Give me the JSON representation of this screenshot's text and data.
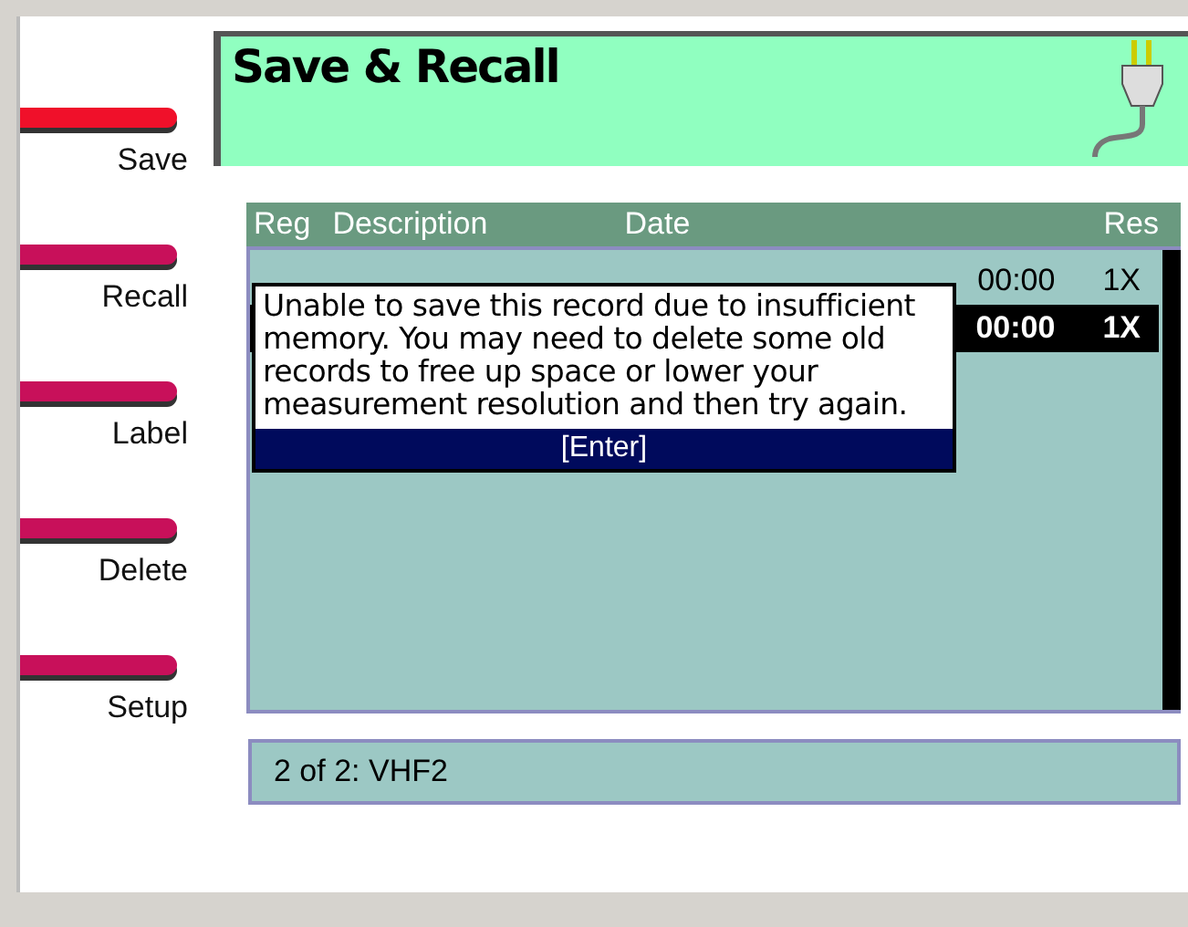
{
  "softkeys": [
    {
      "label": "Save",
      "selected": true
    },
    {
      "label": "Recall",
      "selected": false
    },
    {
      "label": "Label",
      "selected": false
    },
    {
      "label": "Delete",
      "selected": false
    },
    {
      "label": "Setup",
      "selected": false
    }
  ],
  "header": {
    "title": "Save & Recall"
  },
  "table": {
    "columns": [
      "Reg",
      "Description",
      "Date",
      "Res"
    ],
    "rows": [
      {
        "time": "00:00",
        "res": "1X",
        "selected": false
      },
      {
        "time": "00:00",
        "res": "1X",
        "selected": true
      }
    ]
  },
  "dialog": {
    "message": "Unable to save this record due to insufficient memory. You may need to delete some old records to free up space or lower your measurement resolution and then try again.",
    "button": "[Enter]"
  },
  "status_bar": {
    "text": "2 of 2: VHF2"
  }
}
